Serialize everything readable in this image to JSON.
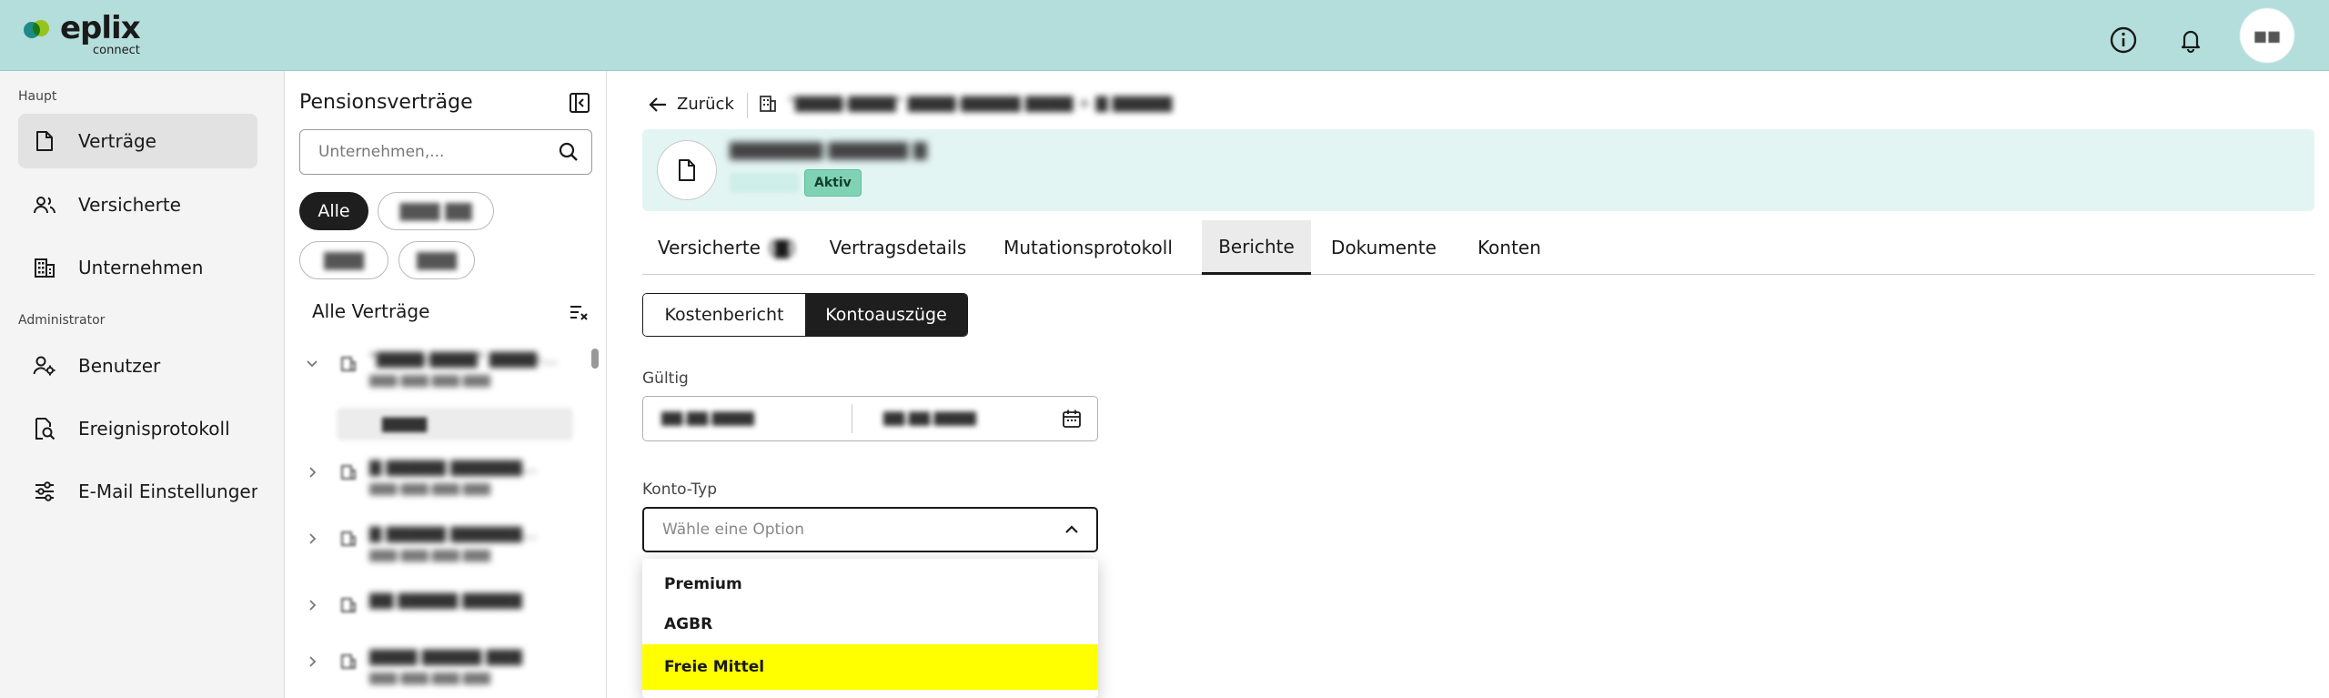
{
  "brand": {
    "name": "eplix",
    "sub": "connect",
    "colors": {
      "topbar": "#b4dedb",
      "accent": "#1e1e1e",
      "highlight": "#ffff00",
      "active_badge": "#7fd3b4"
    }
  },
  "topbar": {
    "icons": [
      "info-icon",
      "bell-icon",
      "avatar"
    ],
    "avatar_initials": "■■"
  },
  "nav": {
    "section_main": "Haupt",
    "section_admin": "Administrator",
    "items": [
      {
        "label": "Verträge",
        "icon": "document-icon",
        "active": true
      },
      {
        "label": "Versicherte",
        "icon": "users-icon",
        "active": false
      },
      {
        "label": "Unternehmen",
        "icon": "building-icon",
        "active": false
      },
      {
        "label": "Benutzer",
        "icon": "user-gear-icon",
        "active": false
      },
      {
        "label": "Ereignisprotokoll",
        "icon": "search-document-icon",
        "active": false
      },
      {
        "label": "E-Mail Einstellungen",
        "icon": "sliders-icon",
        "active": false
      }
    ]
  },
  "panel": {
    "title": "Pensionsverträge",
    "search_placeholder": "Unternehmen,...",
    "chips": [
      "Alle",
      "▇▇▇ ▇▇",
      "▇▇▇",
      "▇▇▇"
    ],
    "list_header": "Alle Verträge",
    "rows": [
      {
        "title": "\"▇▇▇▇-▇▇▇▇\" ▇▇▇▇-...",
        "sub": "▇▇▇-▇▇▇.▇▇▇.▇▇▇"
      },
      {
        "title": "▇ ▇▇▇▇▇ ▇▇▇▇▇▇...",
        "sub": "▇▇▇-▇▇▇.▇▇▇.▇▇▇"
      },
      {
        "title": "▇ ▇▇▇▇▇ ▇▇▇▇▇▇...",
        "sub": "▇▇▇-▇▇▇.▇▇▇.▇▇▇"
      },
      {
        "title": "▇▇ ▇▇▇▇▇ ▇▇▇▇▇",
        "sub": ""
      },
      {
        "title": "▇▇▇▇ ▇▇▇▇▇ ▇▇▇",
        "sub": "▇▇▇-▇▇▇.▇▇▇.▇▇▇"
      }
    ],
    "sub_row": "▇▇▇▇"
  },
  "main": {
    "back_label": "Zurück",
    "breadcrumb": "\"▇▇▇▇-▇▇▇▇\" ▇▇▇▇-▇▇▇▇▇ ▇▇▇▇ + ▇ ▇▇▇▇▇",
    "contract": {
      "name": "▇▇▇▇▇▇▇ ▇▇▇▇▇▇ ▇",
      "status": "Aktiv"
    },
    "tabs": [
      {
        "label": "Versicherte",
        "extra": "(▇)",
        "active": false
      },
      {
        "label": "Vertragsdetails",
        "extra": "",
        "active": false
      },
      {
        "label": "Mutationsprotokoll",
        "extra": "",
        "active": false
      },
      {
        "label": "Berichte",
        "extra": "",
        "active": true
      },
      {
        "label": "Dokumente",
        "extra": "",
        "active": false
      },
      {
        "label": "Konten",
        "extra": "",
        "active": false
      }
    ],
    "segments": {
      "left": "Kostenbericht",
      "right": "Kontoauszüge"
    },
    "gueltig_label": "Gültig",
    "date_from": "▇▇.▇▇.▇▇▇▇",
    "date_to": "▇▇.▇▇.▇▇▇▇",
    "konto_label": "Konto-Typ",
    "konto_placeholder": "Wähle eine Option",
    "options": [
      "Premium",
      "AGBR",
      "Freie Mittel"
    ]
  }
}
